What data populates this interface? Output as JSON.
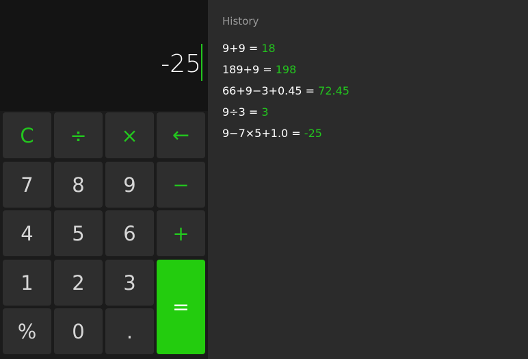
{
  "display": {
    "value": "-25"
  },
  "keypad": {
    "clear": "C",
    "divide": "÷",
    "multiply": "×",
    "backspace": "←",
    "seven": "7",
    "eight": "8",
    "nine": "9",
    "minus": "−",
    "four": "4",
    "five": "5",
    "six": "6",
    "plus": "+",
    "one": "1",
    "two": "2",
    "three": "3",
    "equals": "=",
    "percent": "%",
    "zero": "0",
    "decimal": "."
  },
  "history": {
    "title": "History",
    "items": [
      {
        "expression": "9+9 =",
        "result": "18"
      },
      {
        "expression": "189+9 =",
        "result": "198"
      },
      {
        "expression": "66+9−3+0.45 =",
        "result": "72.45"
      },
      {
        "expression": "9÷3 =",
        "result": "3"
      },
      {
        "expression": "9−7×5+1.0 =",
        "result": "-25"
      }
    ]
  },
  "colors": {
    "accent": "#23c51e",
    "equals_background": "#23cc0e",
    "key_background": "#2e2e2e",
    "display_background": "#141414",
    "history_background": "#2b2b2b"
  }
}
